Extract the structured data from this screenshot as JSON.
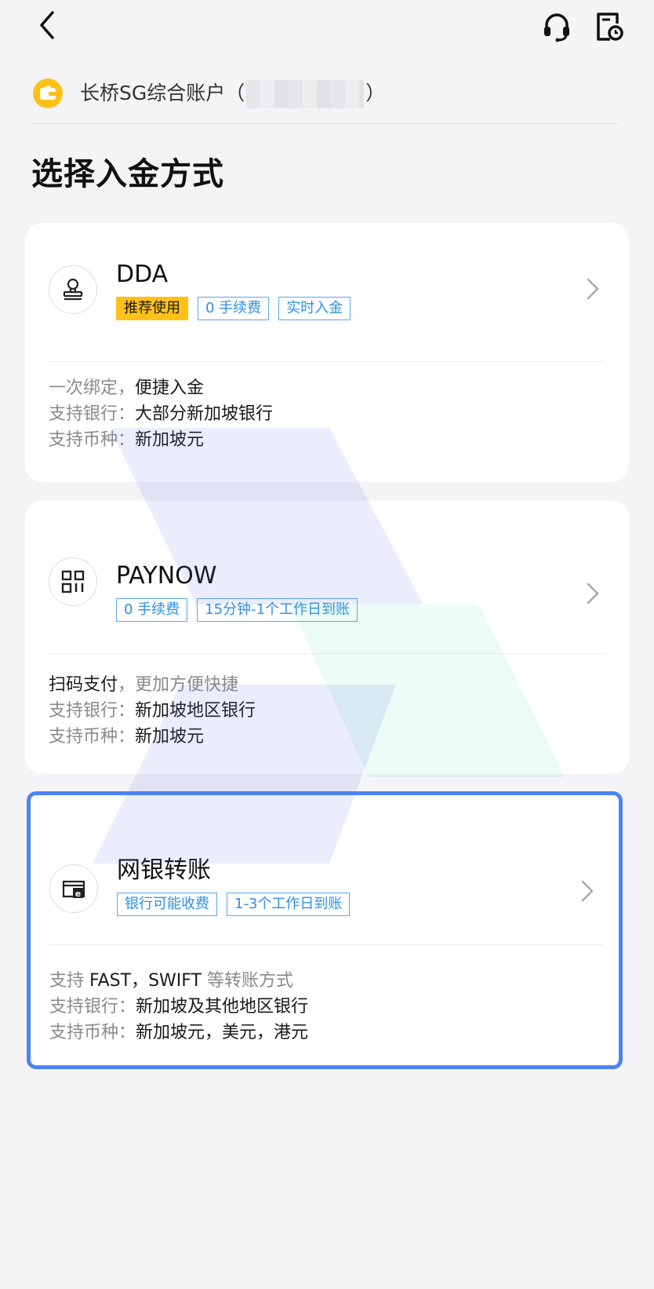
{
  "account": {
    "prefix": "长桥SG综合账户（",
    "suffix": "）"
  },
  "page_title": "选择入金方式",
  "methods": [
    {
      "name": "DDA",
      "icon": "stamp-icon",
      "tags": [
        "推荐使用",
        "0 手续费",
        "实时入金"
      ],
      "info": [
        {
          "label": "一次绑定，",
          "value": "便捷入金"
        },
        {
          "label": "支持银行：",
          "value": "大部分新加坡银行"
        },
        {
          "label": "支持币种：",
          "value": "新加坡元"
        }
      ]
    },
    {
      "name": "PAYNOW",
      "icon": "qr-code-icon",
      "tags": [
        "0 手续费",
        "15分钟-1个工作日到账"
      ],
      "info": [
        {
          "value": "扫码支付",
          "label": "，更加方便快捷"
        },
        {
          "label": "支持银行：",
          "value": "新加坡地区银行"
        },
        {
          "label": "支持币种：",
          "value": "新加坡元"
        }
      ]
    },
    {
      "name": "网银转账",
      "icon": "online-banking-icon",
      "tags": [
        "银行可能收费",
        "1-3个工作日到账"
      ],
      "info": [
        {
          "label": "支持 ",
          "value": "FAST，SWIFT",
          "label2": " 等转账方式"
        },
        {
          "label": "支持银行：",
          "value": "新加坡及其他地区银行"
        },
        {
          "label": "支持币种：",
          "value": "新加坡元，美元，港元"
        }
      ]
    }
  ],
  "colors": {
    "accent": "#4d83f2",
    "tag_blue": "#2e8fe6",
    "highlight_yellow": "#fdc118",
    "background": "#f4f4f6"
  }
}
